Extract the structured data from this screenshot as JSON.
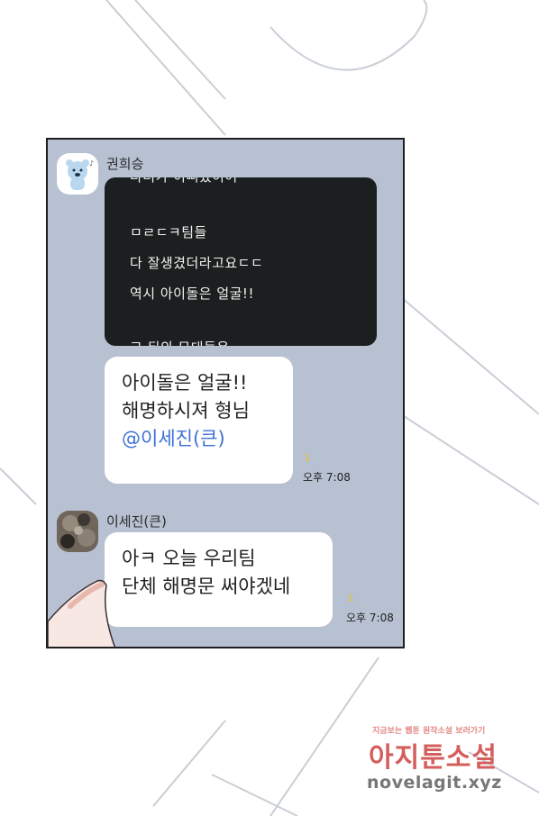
{
  "conversation": {
    "messages": [
      {
        "sender": "권희승",
        "avatar_icon": "blue-bear-avatar-icon",
        "screenshot_lines": [
          "다더가 이뻐졌이어",
          "ㅁㄹㄷㅋ팀들",
          "다 잘생겼더라고요ㄷㄷ",
          "역시 아이돌은 얼굴!!",
          "그 뒤의 무대들은"
        ],
        "text_lines": [
          "아이돌은 얼굴!!",
          "해명하시져 형님"
        ],
        "mention": "@이세진(큰)",
        "time": "오후 7:08"
      },
      {
        "sender": "이세진(큰)",
        "avatar_icon": "photo-avatar-icon",
        "text_lines": [
          "아ㅋ 오늘 우리팀",
          "단체 해명문 써야겠네"
        ],
        "time": "오후 7:08"
      }
    ],
    "read_marker": "1"
  },
  "watermark": {
    "tagline": "지금보는 웹툰 원작소설 보러가기",
    "brand": "아지툰소설",
    "url": "novelagit.xyz"
  },
  "colors": {
    "chat_background": "#b7c1d1",
    "bubble": "#ffffff",
    "dark_bubble": "#1c1f1f",
    "mention": "#3d71d6",
    "read_marker": "#f0c400",
    "watermark_brand": "#d45e5c"
  }
}
